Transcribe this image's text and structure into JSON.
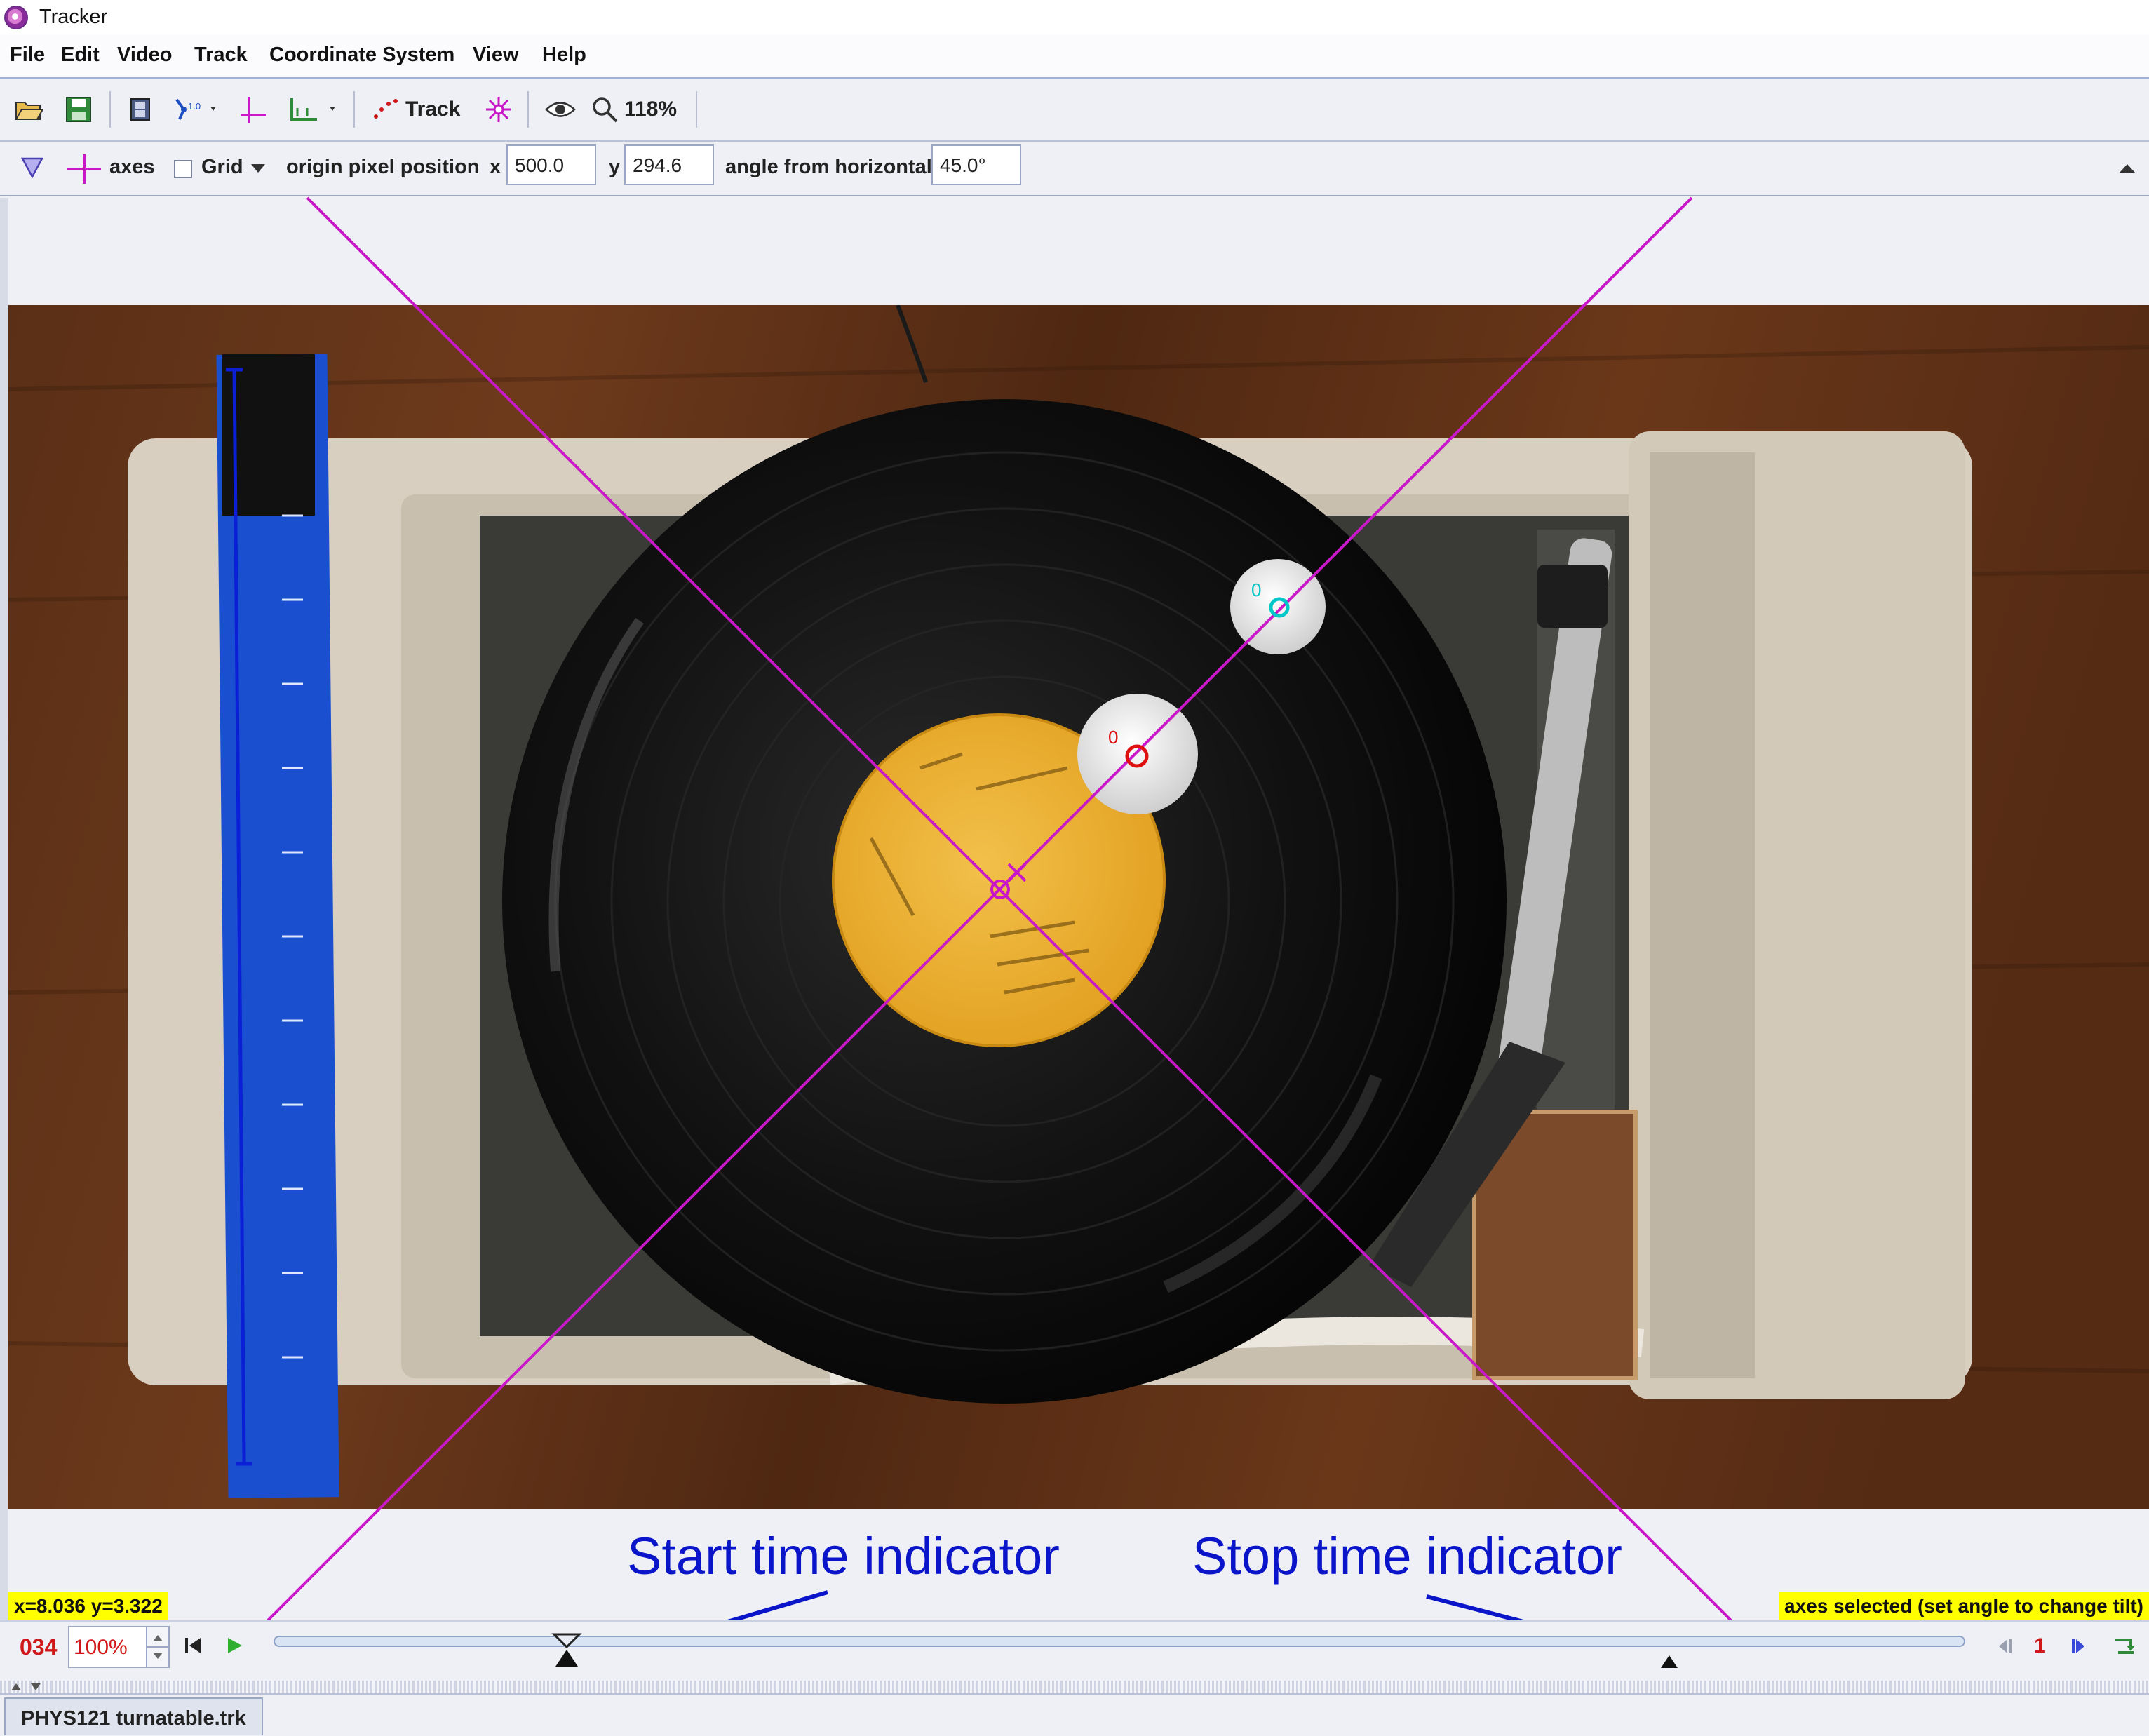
{
  "window": {
    "title": "Tracker"
  },
  "menu": [
    "File",
    "Edit",
    "Video",
    "Track",
    "Coordinate System",
    "View",
    "Help"
  ],
  "toolbar": {
    "track_label": "Track",
    "zoom_label": "118%",
    "icons": [
      "open-folder-icon",
      "save-disk-icon",
      "video-clip-icon",
      "calibration-tools-icon",
      "axes-icon",
      "measuring-tools-icon",
      "track-icon",
      "autotracker-icon",
      "eye-icon",
      "zoom-icon"
    ]
  },
  "axes_bar": {
    "axes_label": "axes",
    "grid_label": "Grid",
    "grid_checked": false,
    "origin_label": "origin pixel position",
    "x_label": "x",
    "x_value": "500.0",
    "y_label": "y",
    "y_value": "294.6",
    "angle_label": "angle from horizontal",
    "angle_value": "45.0°"
  },
  "video": {
    "markers": [
      {
        "label": "0",
        "color": "#00c8c8"
      },
      {
        "label": "0",
        "color": "#e01010"
      }
    ]
  },
  "readouts": {
    "coords": "x=8.036  y=3.322",
    "status": "axes selected (set angle to change tilt)"
  },
  "annotations": {
    "start": "Start time indicator",
    "stop": "Stop time indicator"
  },
  "player": {
    "frame": "034",
    "rate": "100%",
    "step_size": "1"
  },
  "bottom_tab": {
    "label": "PHYS121 turnatable.trk"
  },
  "colors": {
    "axes": "#c818c8",
    "annotation": "#0a14c8",
    "readout_bg": "#ffff00",
    "frame_counter": "#d01818",
    "ruler": "#1a4fd0",
    "record_label": "#e9a624"
  }
}
